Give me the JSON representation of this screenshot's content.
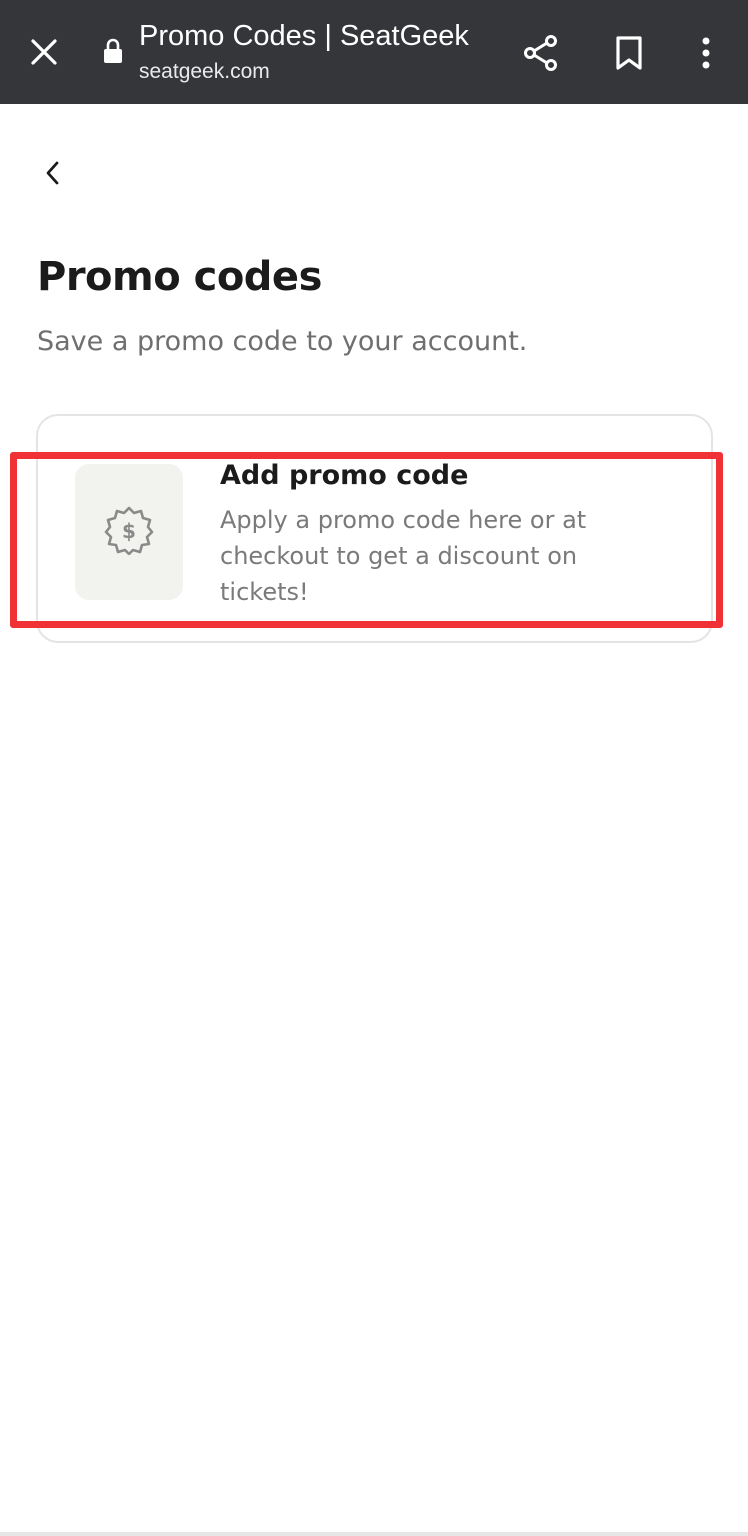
{
  "browser": {
    "page_title": "Promo Codes | SeatGeek",
    "url": "seatgeek.com",
    "icons": {
      "close": "close-icon",
      "lock": "lock-icon",
      "share": "share-icon",
      "bookmark": "bookmark-icon",
      "menu": "more-vert-icon"
    }
  },
  "page": {
    "back_icon": "chevron-left-icon",
    "title": "Promo codes",
    "subtitle": "Save a promo code to your account."
  },
  "promo_card": {
    "icon": "dollar-badge-icon",
    "title": "Add promo code",
    "description": "Apply a promo code here or at checkout to get a discount on tickets!"
  },
  "colors": {
    "browser_bar": "#35363a",
    "highlight": "#f03236",
    "icon_bg": "#f2f2ef"
  }
}
